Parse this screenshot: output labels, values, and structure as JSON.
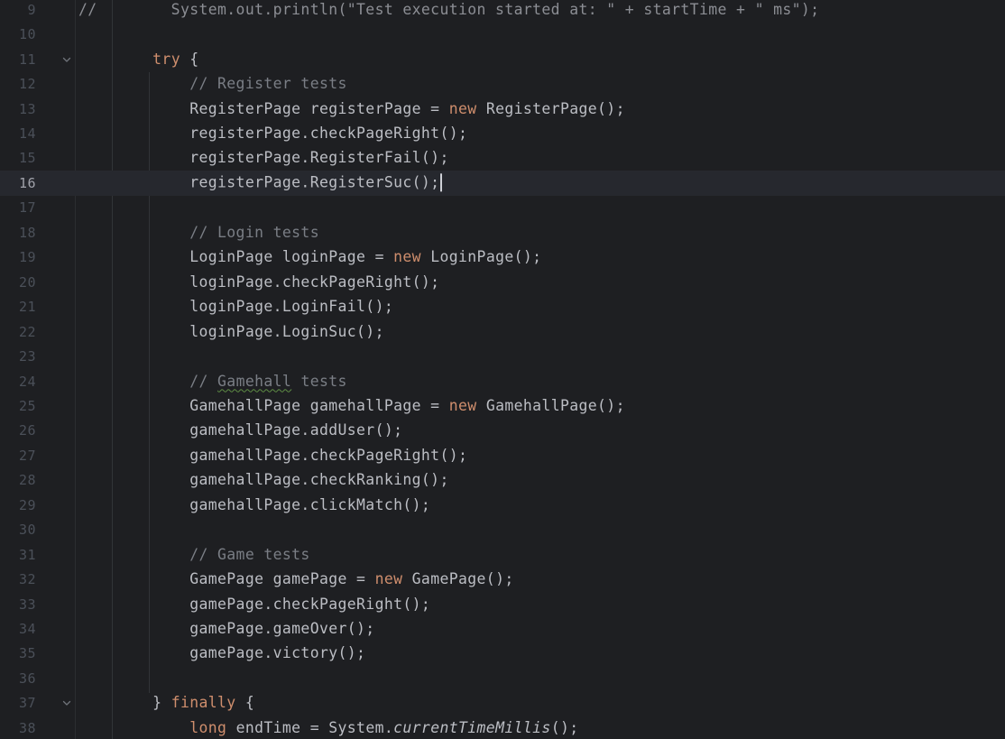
{
  "editor": {
    "current_line": 16,
    "lines": [
      {
        "n": "9",
        "segments": [
          {
            "t": "//        System.out.println(\"Test execution started at: \" + startTime + \" ms\");",
            "c": "plain-gray"
          }
        ]
      },
      {
        "n": "10",
        "segments": []
      },
      {
        "n": "11",
        "fold": true,
        "segments": [
          {
            "t": "        "
          },
          {
            "t": "try",
            "c": "kw"
          },
          {
            "t": " {"
          }
        ]
      },
      {
        "n": "12",
        "segments": [
          {
            "t": "            "
          },
          {
            "t": "// Register tests",
            "c": "cm"
          }
        ]
      },
      {
        "n": "13",
        "segments": [
          {
            "t": "            RegisterPage registerPage = "
          },
          {
            "t": "new",
            "c": "kw"
          },
          {
            "t": " RegisterPage();"
          }
        ]
      },
      {
        "n": "14",
        "segments": [
          {
            "t": "            registerPage.checkPageRight();"
          }
        ]
      },
      {
        "n": "15",
        "segments": [
          {
            "t": "            registerPage.RegisterFail();"
          }
        ]
      },
      {
        "n": "16",
        "current": true,
        "caret": true,
        "segments": [
          {
            "t": "            registerPage.RegisterSuc();"
          }
        ]
      },
      {
        "n": "17",
        "segments": []
      },
      {
        "n": "18",
        "segments": [
          {
            "t": "            "
          },
          {
            "t": "// Login tests",
            "c": "cm"
          }
        ]
      },
      {
        "n": "19",
        "segments": [
          {
            "t": "            LoginPage loginPage = "
          },
          {
            "t": "new",
            "c": "kw"
          },
          {
            "t": " LoginPage();"
          }
        ]
      },
      {
        "n": "20",
        "segments": [
          {
            "t": "            loginPage.checkPageRight();"
          }
        ]
      },
      {
        "n": "21",
        "segments": [
          {
            "t": "            loginPage.LoginFail();"
          }
        ]
      },
      {
        "n": "22",
        "segments": [
          {
            "t": "            loginPage.LoginSuc();"
          }
        ]
      },
      {
        "n": "23",
        "segments": []
      },
      {
        "n": "24",
        "segments": [
          {
            "t": "            "
          },
          {
            "t": "// ",
            "c": "cm"
          },
          {
            "t": "Gamehall",
            "c": "cm typo"
          },
          {
            "t": " tests",
            "c": "cm"
          }
        ]
      },
      {
        "n": "25",
        "segments": [
          {
            "t": "            GamehallPage gamehallPage = "
          },
          {
            "t": "new",
            "c": "kw"
          },
          {
            "t": " GamehallPage();"
          }
        ]
      },
      {
        "n": "26",
        "segments": [
          {
            "t": "            gamehallPage.addUser();"
          }
        ]
      },
      {
        "n": "27",
        "segments": [
          {
            "t": "            gamehallPage.checkPageRight();"
          }
        ]
      },
      {
        "n": "28",
        "segments": [
          {
            "t": "            gamehallPage.checkRanking();"
          }
        ]
      },
      {
        "n": "29",
        "segments": [
          {
            "t": "            gamehallPage.clickMatch();"
          }
        ]
      },
      {
        "n": "30",
        "segments": []
      },
      {
        "n": "31",
        "segments": [
          {
            "t": "            "
          },
          {
            "t": "// Game tests",
            "c": "cm"
          }
        ]
      },
      {
        "n": "32",
        "segments": [
          {
            "t": "            GamePage gamePage = "
          },
          {
            "t": "new",
            "c": "kw"
          },
          {
            "t": " GamePage();"
          }
        ]
      },
      {
        "n": "33",
        "segments": [
          {
            "t": "            gamePage.checkPageRight();"
          }
        ]
      },
      {
        "n": "34",
        "segments": [
          {
            "t": "            gamePage.gameOver();"
          }
        ]
      },
      {
        "n": "35",
        "segments": [
          {
            "t": "            gamePage.victory();"
          }
        ]
      },
      {
        "n": "36",
        "segments": []
      },
      {
        "n": "37",
        "fold": true,
        "segments": [
          {
            "t": "        } "
          },
          {
            "t": "finally",
            "c": "kw"
          },
          {
            "t": " {"
          }
        ]
      },
      {
        "n": "38",
        "segments": [
          {
            "t": "            "
          },
          {
            "t": "long",
            "c": "kw"
          },
          {
            "t": " endTime = System."
          },
          {
            "t": "currentTimeMillis",
            "c": "it"
          },
          {
            "t": "();"
          }
        ]
      }
    ]
  }
}
